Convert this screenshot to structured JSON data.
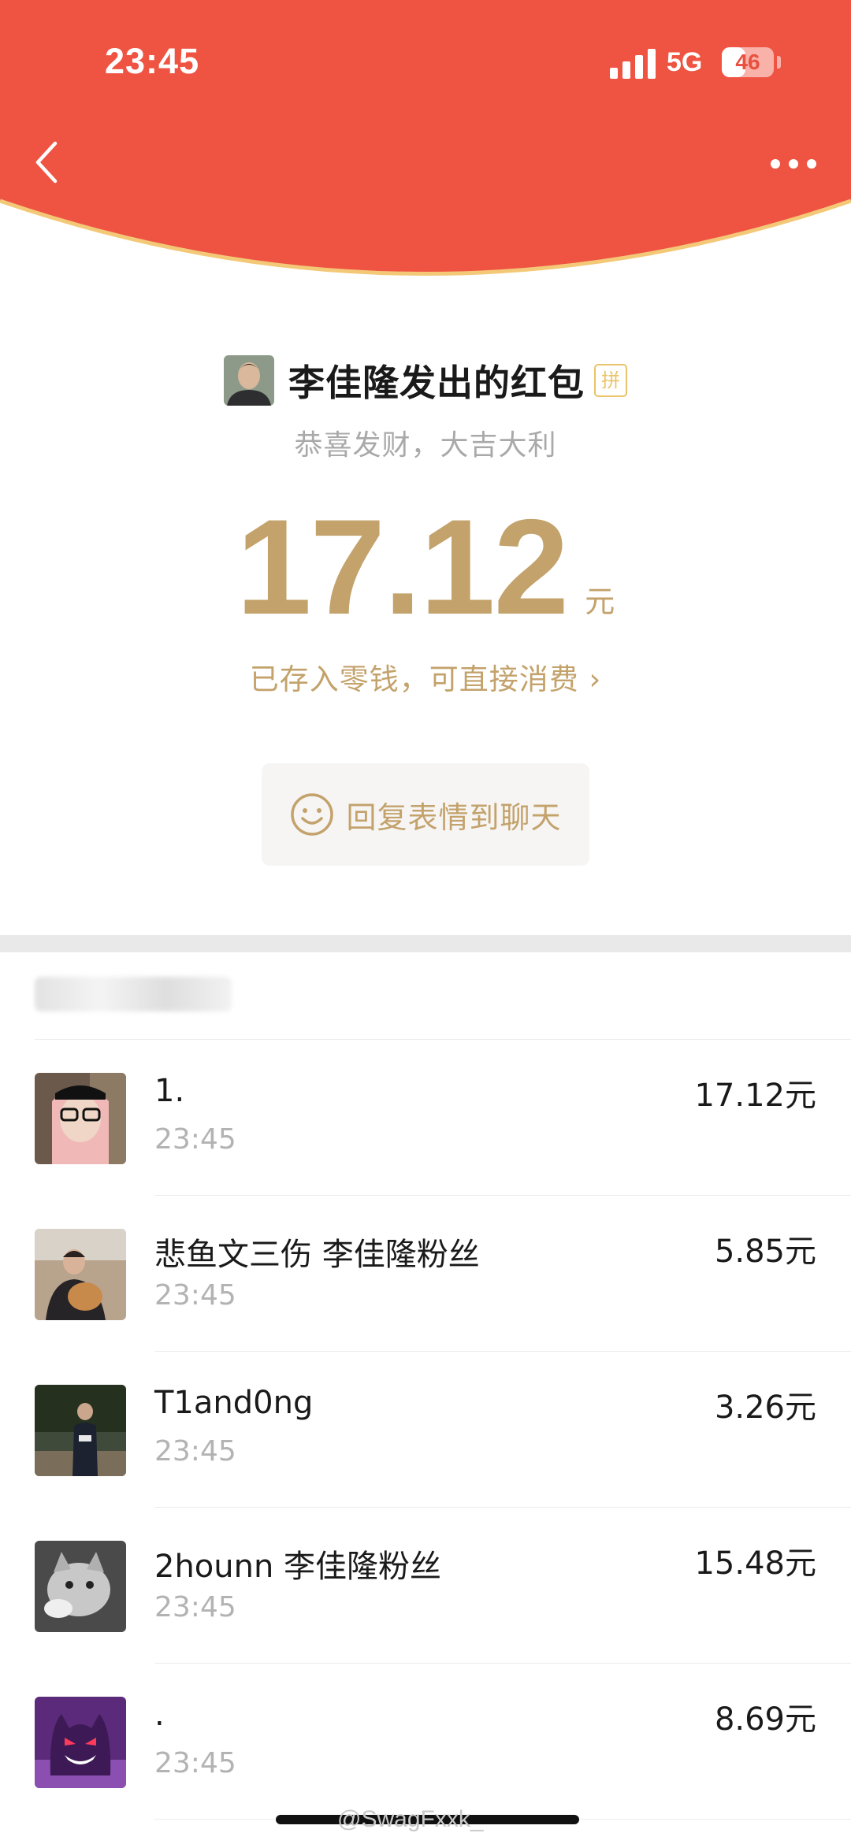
{
  "status_bar": {
    "time": "23:45",
    "network": "5G",
    "battery": "46",
    "battery_level": 0.46
  },
  "colors": {
    "header_red": "#ef5443",
    "gold": "#c3a26b",
    "badge_gold": "#e9c46b"
  },
  "header": {
    "back_icon": "chevron-left-icon",
    "more_icon": "more-dots-icon"
  },
  "envelope": {
    "sender_title": "李佳隆发出的红包",
    "group_badge": "拼",
    "blessing": "恭喜发财，大吉大利",
    "amount": "17.12",
    "unit": "元",
    "change_link": "已存入零钱，可直接消费 ›",
    "reply_button": "回复表情到聊天"
  },
  "recipients": [
    {
      "name": "1.",
      "time": "23:45",
      "amount": "17.12元"
    },
    {
      "name": "悲鱼文三伤 李佳隆粉丝",
      "time": "23:45",
      "amount": "5.85元"
    },
    {
      "name": "T1and0ng",
      "time": "23:45",
      "amount": "3.26元"
    },
    {
      "name": "2hounn 李佳隆粉丝",
      "time": "23:45",
      "amount": "15.48元"
    },
    {
      "name": ".",
      "time": "23:45",
      "amount": "8.69元"
    }
  ],
  "watermark": "@SwagFxxk_"
}
